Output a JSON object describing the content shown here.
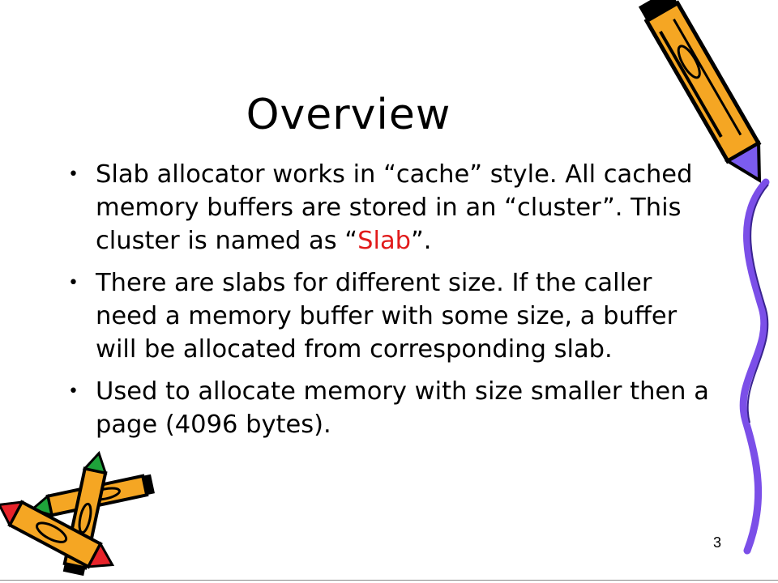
{
  "slide": {
    "title": "Overview",
    "bullets": [
      {
        "segments": [
          {
            "text": "Slab allocator works in “cache” style. All cached memory buffers are stored in an “cluster”. This cluster is named as “"
          },
          {
            "text": "Slab",
            "color": "#e11b1b"
          },
          {
            "text": "”."
          }
        ]
      },
      {
        "segments": [
          {
            "text": "There are slabs for different size. If the caller need a memory buffer with some size, a buffer will be allocated from corresponding slab."
          }
        ]
      },
      {
        "segments": [
          {
            "text": "Used to allocate memory with size smaller then a page (4096 bytes)."
          }
        ]
      }
    ],
    "bullet_char": "•",
    "page_number": "3"
  },
  "decorations": {
    "top_right": "pencil-clipart",
    "bottom_left": "crossed-pencils-clipart",
    "right_edge": "purple-ribbon",
    "colors": {
      "pencil_body": "#f5a623",
      "pencil_dark": "#000000",
      "pencil_accent": "#7b5cf0",
      "pencil_red": "#e8232a",
      "pencil_green": "#1ea33a",
      "ribbon": "#7b4fe8"
    }
  }
}
